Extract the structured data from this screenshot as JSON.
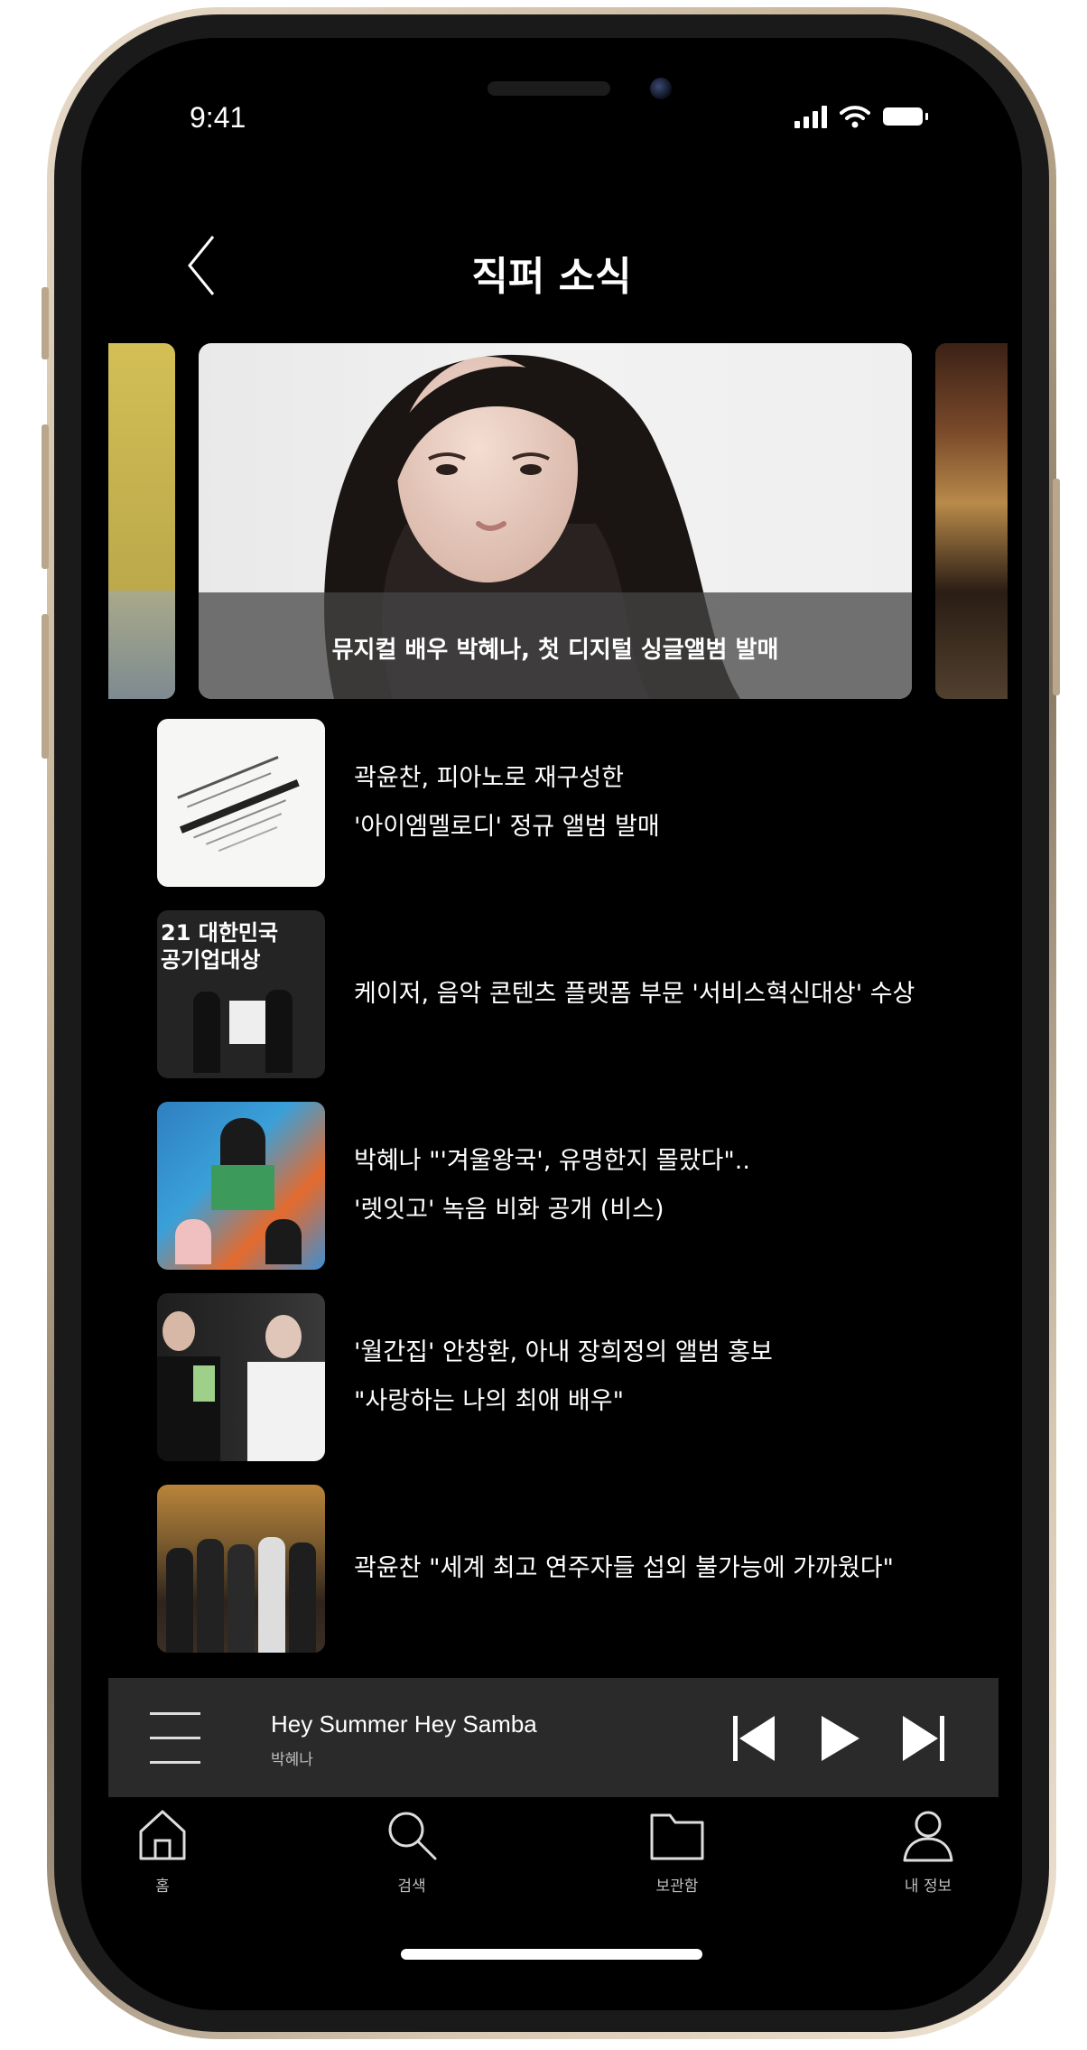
{
  "status_bar": {
    "time": "9:41"
  },
  "header": {
    "title": "직퍼 소식"
  },
  "carousel": {
    "featured_caption": "뮤지컬 배우 박혜나, 첫 디지털 싱글앨범 발매"
  },
  "news": [
    {
      "lines": [
        "곽윤찬, 피아노로 재구성한",
        "'아이엠멜로디' 정규 앨범 발매"
      ]
    },
    {
      "lines": [
        "케이저, 음악 콘텐츠 플랫폼 부문 '서비스혁신대상' 수상"
      ],
      "thumb_text": [
        "21 대한민국",
        "공기업대상"
      ]
    },
    {
      "lines": [
        "박혜나 \"'겨울왕국', 유명한지 몰랐다\"..",
        "'렛잇고' 녹음 비화 공개 (비스)"
      ]
    },
    {
      "lines": [
        "'월간집' 안창환, 아내 장희정의 앨범 홍보",
        "\"사랑하는 나의 최애 배우\""
      ]
    },
    {
      "lines": [
        "곽윤찬 \"세계 최고 연주자들 섭외 불가능에 가까웠다\""
      ]
    }
  ],
  "player": {
    "song_title": "Hey Summer Hey Samba",
    "artist": "박혜나"
  },
  "tabs": [
    {
      "label": "홈",
      "icon": "home-icon"
    },
    {
      "label": "검색",
      "icon": "search-icon"
    },
    {
      "label": "보관함",
      "icon": "folder-icon"
    },
    {
      "label": "내 정보",
      "icon": "user-icon"
    }
  ],
  "colors": {
    "background": "#000000",
    "player_bg": "#2a2a2a",
    "text": "#ffffff",
    "frame_gold": "#c5b296"
  }
}
